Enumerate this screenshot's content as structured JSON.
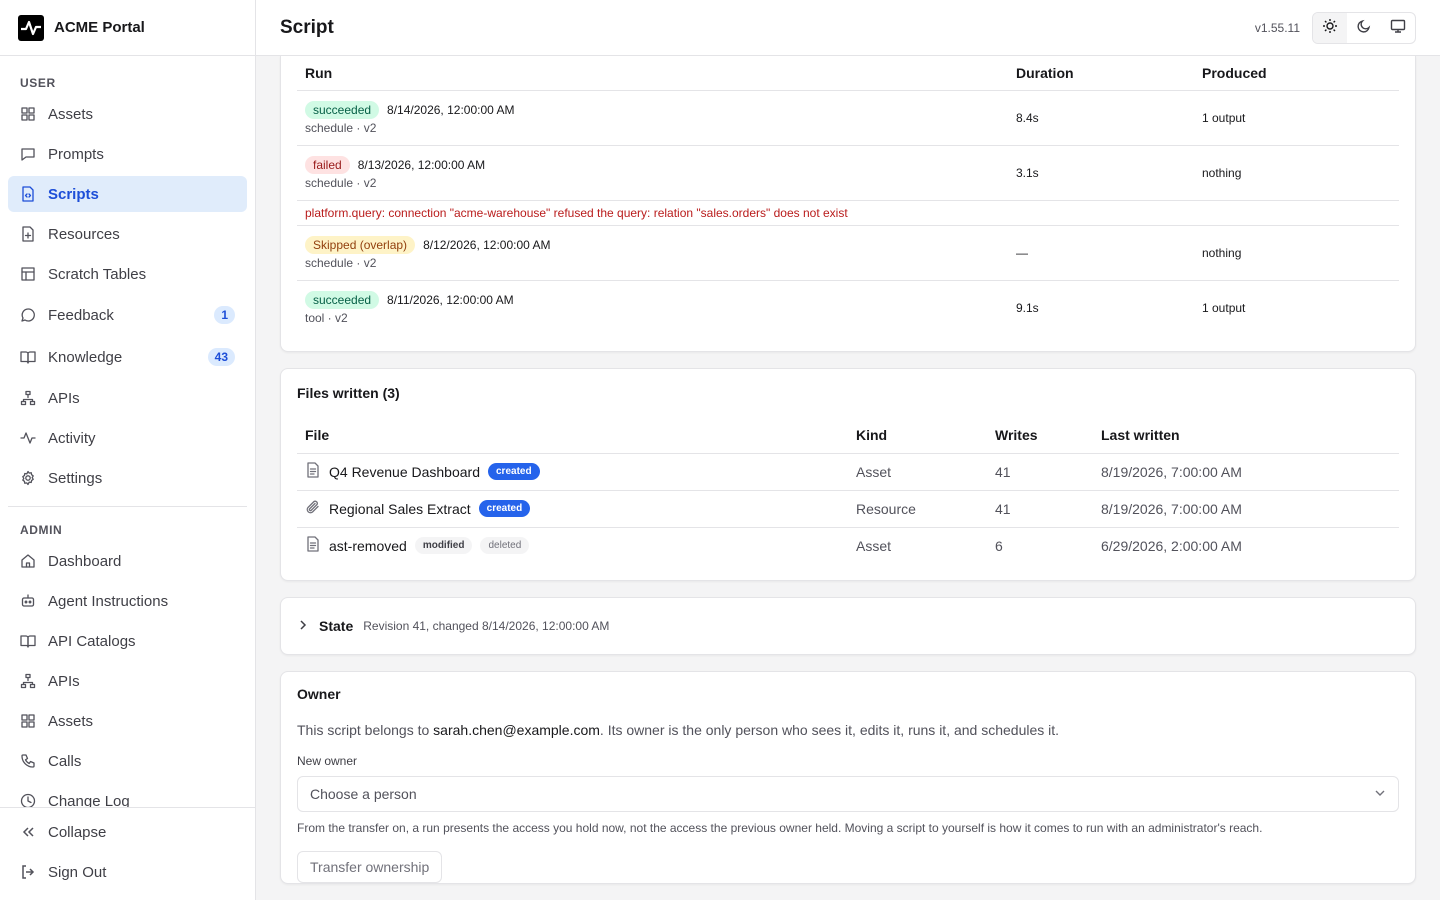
{
  "brand": {
    "name": "ACME Portal"
  },
  "header": {
    "title": "Script",
    "version": "v1.55.11"
  },
  "sidebar": {
    "user_label": "USER",
    "user_items": [
      {
        "label": "Assets",
        "icon": "grid-icon"
      },
      {
        "label": "Prompts",
        "icon": "message-square-icon"
      },
      {
        "label": "Scripts",
        "icon": "file-code-icon",
        "active": true
      },
      {
        "label": "Resources",
        "icon": "file-plus-icon"
      },
      {
        "label": "Scratch Tables",
        "icon": "table-icon"
      },
      {
        "label": "Feedback",
        "icon": "message-circle-icon",
        "count": "1"
      },
      {
        "label": "Knowledge",
        "icon": "book-open-icon",
        "count": "43"
      },
      {
        "label": "APIs",
        "icon": "network-icon"
      },
      {
        "label": "Activity",
        "icon": "activity-icon"
      },
      {
        "label": "Settings",
        "icon": "gear-icon"
      }
    ],
    "admin_label": "ADMIN",
    "admin_items": [
      {
        "label": "Dashboard",
        "icon": "home-icon"
      },
      {
        "label": "Agent Instructions",
        "icon": "bot-icon"
      },
      {
        "label": "API Catalogs",
        "icon": "book-open-icon"
      },
      {
        "label": "APIs",
        "icon": "network-icon"
      },
      {
        "label": "Assets",
        "icon": "grid-icon"
      },
      {
        "label": "Calls",
        "icon": "phone-icon"
      },
      {
        "label": "Change Log",
        "icon": "clock-icon"
      }
    ],
    "collapse_label": "Collapse",
    "signout_label": "Sign Out"
  },
  "runs": {
    "headers": {
      "run": "Run",
      "duration": "Duration",
      "produced": "Produced"
    },
    "rows": [
      {
        "status": "succeeded",
        "status_kind": "ok",
        "time": "8/14/2026, 12:00:00 AM",
        "sub": "schedule · v2",
        "duration": "8.4s",
        "produced": "1 output"
      },
      {
        "status": "failed",
        "status_kind": "fail",
        "time": "8/13/2026, 12:00:00 AM",
        "sub": "schedule · v2",
        "duration": "3.1s",
        "produced": "nothing",
        "error": "platform.query: connection \"acme-warehouse\" refused the query: relation \"sales.orders\" does not exist"
      },
      {
        "status": "Skipped (overlap)",
        "status_kind": "skip",
        "time": "8/12/2026, 12:00:00 AM",
        "sub": "schedule · v2",
        "duration": "—",
        "produced": "nothing"
      },
      {
        "status": "succeeded",
        "status_kind": "ok",
        "time": "8/11/2026, 12:00:00 AM",
        "sub": "tool · v2",
        "duration": "9.1s",
        "produced": "1 output"
      }
    ]
  },
  "files": {
    "title": "Files written (3)",
    "headers": {
      "file": "File",
      "kind": "Kind",
      "writes": "Writes",
      "last": "Last written"
    },
    "rows": [
      {
        "name": "Q4 Revenue Dashboard",
        "icon": "file-text-icon",
        "tags": [
          {
            "label": "created",
            "kind": "created"
          }
        ],
        "kind": "Asset",
        "writes": "41",
        "last": "8/19/2026, 7:00:00 AM"
      },
      {
        "name": "Regional Sales Extract",
        "icon": "paperclip-icon",
        "tags": [
          {
            "label": "created",
            "kind": "created"
          }
        ],
        "kind": "Resource",
        "writes": "41",
        "last": "8/19/2026, 7:00:00 AM"
      },
      {
        "name": "ast-removed",
        "icon": "file-text-icon",
        "tags": [
          {
            "label": "modified",
            "kind": "modified"
          },
          {
            "label": "deleted",
            "kind": "deleted"
          }
        ],
        "kind": "Asset",
        "writes": "6",
        "last": "6/29/2026, 2:00:00 AM"
      }
    ]
  },
  "state": {
    "label": "State",
    "meta": "Revision 41, changed 8/14/2026, 12:00:00 AM"
  },
  "owner": {
    "title": "Owner",
    "desc_prefix": "This script belongs to ",
    "email": "sarah.chen@example.com",
    "desc_suffix": ". Its owner is the only person who sees it, edits it, runs it, and schedules it.",
    "field_label": "New owner",
    "select_placeholder": "Choose a person",
    "hint": "From the transfer on, a run presents the access you hold now, not the access the previous owner held. Moving a script to yourself is how it comes to run with an administrator's reach.",
    "button": "Transfer ownership"
  }
}
